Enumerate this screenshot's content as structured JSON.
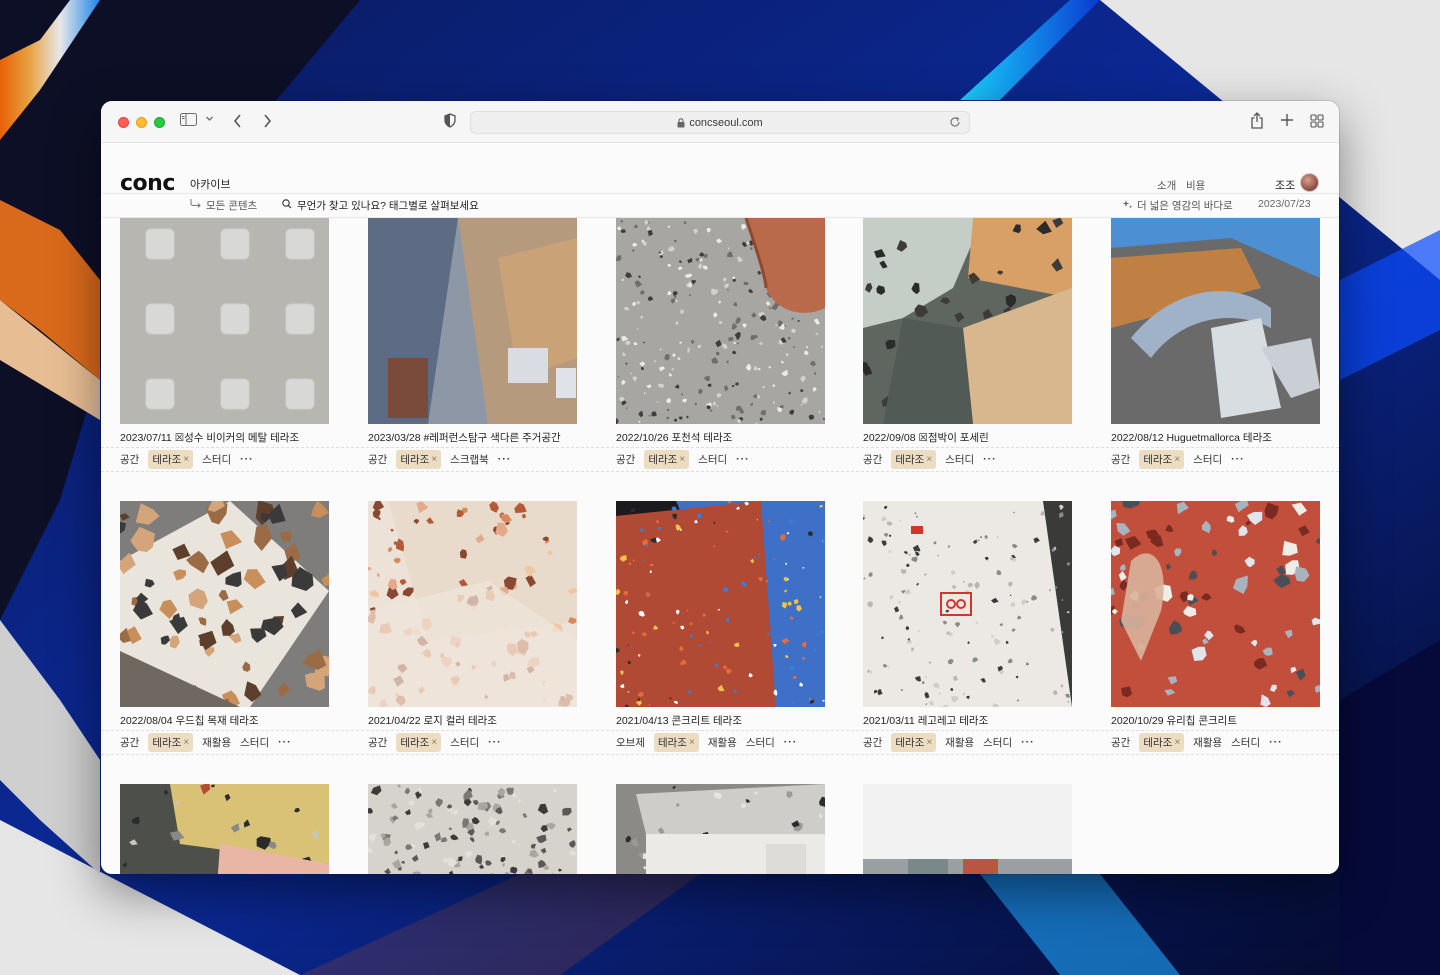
{
  "browser": {
    "url": "concseoul.com"
  },
  "site": {
    "logo": "conc",
    "nav_archive": "아카이브",
    "nav_about": "소개",
    "nav_cost": "비용",
    "user_name": "조조",
    "all_content": "모든 콘텐츠",
    "search_placeholder": "무언가 찾고 있나요? 태그별로 살펴보세요",
    "inspiration": "더 넓은 영감의 바다로",
    "date": "2023/07/23"
  },
  "cards": [
    {
      "title": "2023/07/11 ☒성수 비이커의 메탈 테라조",
      "tags": [
        "공간",
        "테라조",
        "스터디"
      ],
      "active": 1
    },
    {
      "title": "2023/03/28 #레퍼런스탐구 색다른 주거공간",
      "tags": [
        "공간",
        "테라조",
        "스크랩북"
      ],
      "active": 1
    },
    {
      "title": "2022/10/26 포천석 테라조",
      "tags": [
        "공간",
        "테라조",
        "스터디"
      ],
      "active": 1
    },
    {
      "title": "2022/09/08 ☒점박이 포세린",
      "tags": [
        "공간",
        "테라조",
        "스터디"
      ],
      "active": 1
    },
    {
      "title": "2022/08/12 Huguetmallorca 테라조",
      "tags": [
        "공간",
        "테라조",
        "스터디"
      ],
      "active": 1
    },
    {
      "title": "2022/08/04 우드칩 목재 테라조",
      "tags": [
        "공간",
        "테라조",
        "재활용",
        "스터디"
      ],
      "active": 1
    },
    {
      "title": "2021/04/22 로지 컬러 테라조",
      "tags": [
        "공간",
        "테라조",
        "스터디"
      ],
      "active": 1
    },
    {
      "title": "2021/04/13 콘크리트 테라조",
      "tags": [
        "오브제",
        "테라조",
        "재활용",
        "스터디"
      ],
      "active": 1
    },
    {
      "title": "2021/03/11 레고레고 테라조",
      "tags": [
        "공간",
        "테라조",
        "재활용",
        "스터디"
      ],
      "active": 1
    },
    {
      "title": "2020/10/29 유리칩 콘크리트",
      "tags": [
        "공간",
        "테라조",
        "재활용",
        "스터디"
      ],
      "active": 1
    }
  ],
  "more_label": "···",
  "tag_close": "×"
}
